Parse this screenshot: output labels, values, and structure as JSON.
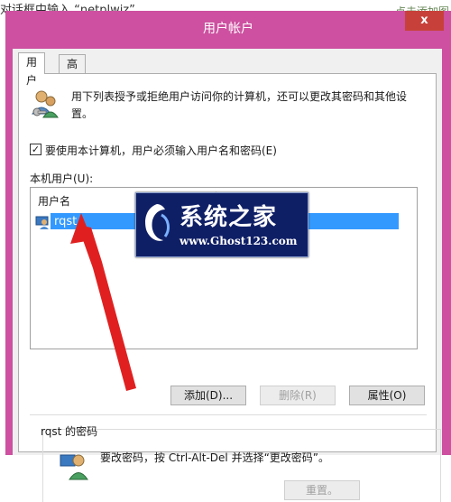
{
  "background": {
    "instruction_fragment": "对话框中输入 “netplwiz”",
    "link_fragment": "点击添加图"
  },
  "window": {
    "title": "用户帐户",
    "close_label": "x"
  },
  "tabs": [
    {
      "label": "用户",
      "active": true
    },
    {
      "label": "高级",
      "active": false
    }
  ],
  "intro_text": "用下列表授予或拒绝用户访问你的计算机，还可以更改其密码和其他设置。",
  "require_password": {
    "label": "要使用本计算机，用户必须输入用户名和密码(E)",
    "checked": true
  },
  "users_label": "本机用户(U):",
  "list": {
    "columns": [
      "用户名",
      "组"
    ],
    "rows": [
      {
        "name": "rqst",
        "group": "",
        "selected": true
      }
    ]
  },
  "buttons": {
    "add": "添加(D)...",
    "remove": "删除(R)",
    "properties": "属性(O)",
    "reset": "重置。"
  },
  "password_section": {
    "title": "rqst 的密码",
    "text": "要改密码，按 Ctrl-Alt-Del 并选择“更改密码”。"
  },
  "watermark": {
    "title": "系统之家",
    "url": "www.Ghost123.com"
  },
  "colors": {
    "titlebar": "#cd51a0",
    "selection": "#3399ff",
    "close_button": "#c7413a",
    "arrow": "#e02020",
    "watermark_bg": "#0f1f66"
  }
}
